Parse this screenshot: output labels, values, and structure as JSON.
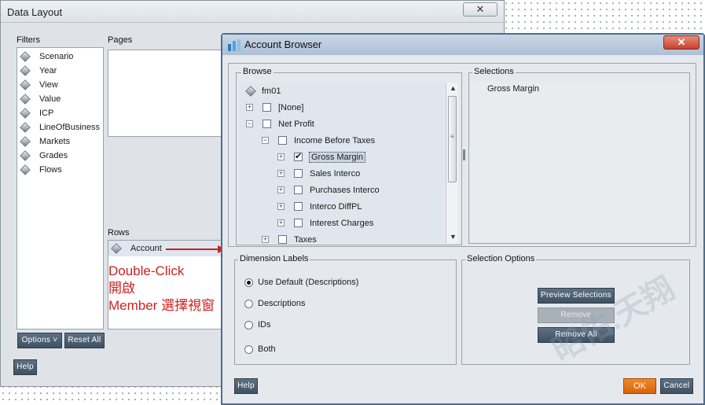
{
  "data_layout": {
    "title": "Data Layout",
    "close_glyph": "✕",
    "filters_label": "Filters",
    "pages_label": "Pages",
    "rows_label": "Rows",
    "filters": [
      "Scenario",
      "Year",
      "View",
      "Value",
      "ICP",
      "LineOfBusiness",
      "Markets",
      "Grades",
      "Flows"
    ],
    "row_item": "Account",
    "options_button": "Options",
    "reset_all_button": "Reset All",
    "help_button": "Help"
  },
  "annotation": {
    "line1": "Double-Click",
    "line2": "開啟",
    "line3": "Member 選擇視窗",
    "arrow_color": "#d12020"
  },
  "account_browser": {
    "title": "Account Browser",
    "close_glyph": "✕",
    "browse_label": "Browse",
    "selections_label": "Selections",
    "tree": [
      {
        "label": "fm01",
        "indent": 0,
        "expander": "",
        "checkbox": false,
        "checked": false,
        "root": true
      },
      {
        "label": "[None]",
        "indent": 0,
        "expander": "+",
        "checkbox": true,
        "checked": false
      },
      {
        "label": "Net Profit",
        "indent": 0,
        "expander": "−",
        "checkbox": true,
        "checked": false
      },
      {
        "label": "Income Before Taxes",
        "indent": 1,
        "expander": "−",
        "checkbox": true,
        "checked": false
      },
      {
        "label": "Gross Margin",
        "indent": 2,
        "expander": "+",
        "checkbox": true,
        "checked": true,
        "selected": true
      },
      {
        "label": "Sales Interco",
        "indent": 2,
        "expander": "+",
        "checkbox": true,
        "checked": false
      },
      {
        "label": "Purchases Interco",
        "indent": 2,
        "expander": "+",
        "checkbox": true,
        "checked": false
      },
      {
        "label": "Interco DiffPL",
        "indent": 2,
        "expander": "+",
        "checkbox": true,
        "checked": false
      },
      {
        "label": "Interest Charges",
        "indent": 2,
        "expander": "+",
        "checkbox": true,
        "checked": false
      },
      {
        "label": "Taxes",
        "indent": 1,
        "expander": "+",
        "checkbox": true,
        "checked": false
      }
    ],
    "selections": [
      "Gross Margin"
    ],
    "dimension_labels_title": "Dimension Labels",
    "dimension_labels": [
      {
        "label": "Use Default (Descriptions)",
        "selected": true
      },
      {
        "label": "Descriptions",
        "selected": false
      },
      {
        "label": "IDs",
        "selected": false
      },
      {
        "label": "Both",
        "selected": false
      }
    ],
    "selection_options_title": "Selection Options",
    "preview_selections_button": "Preview Selections",
    "remove_button": "Remove",
    "remove_all_button": "Remove All",
    "help_button": "Help",
    "ok_button": "OK",
    "cancel_button": "Cancel",
    "watermark": "昭佑.天翔"
  }
}
